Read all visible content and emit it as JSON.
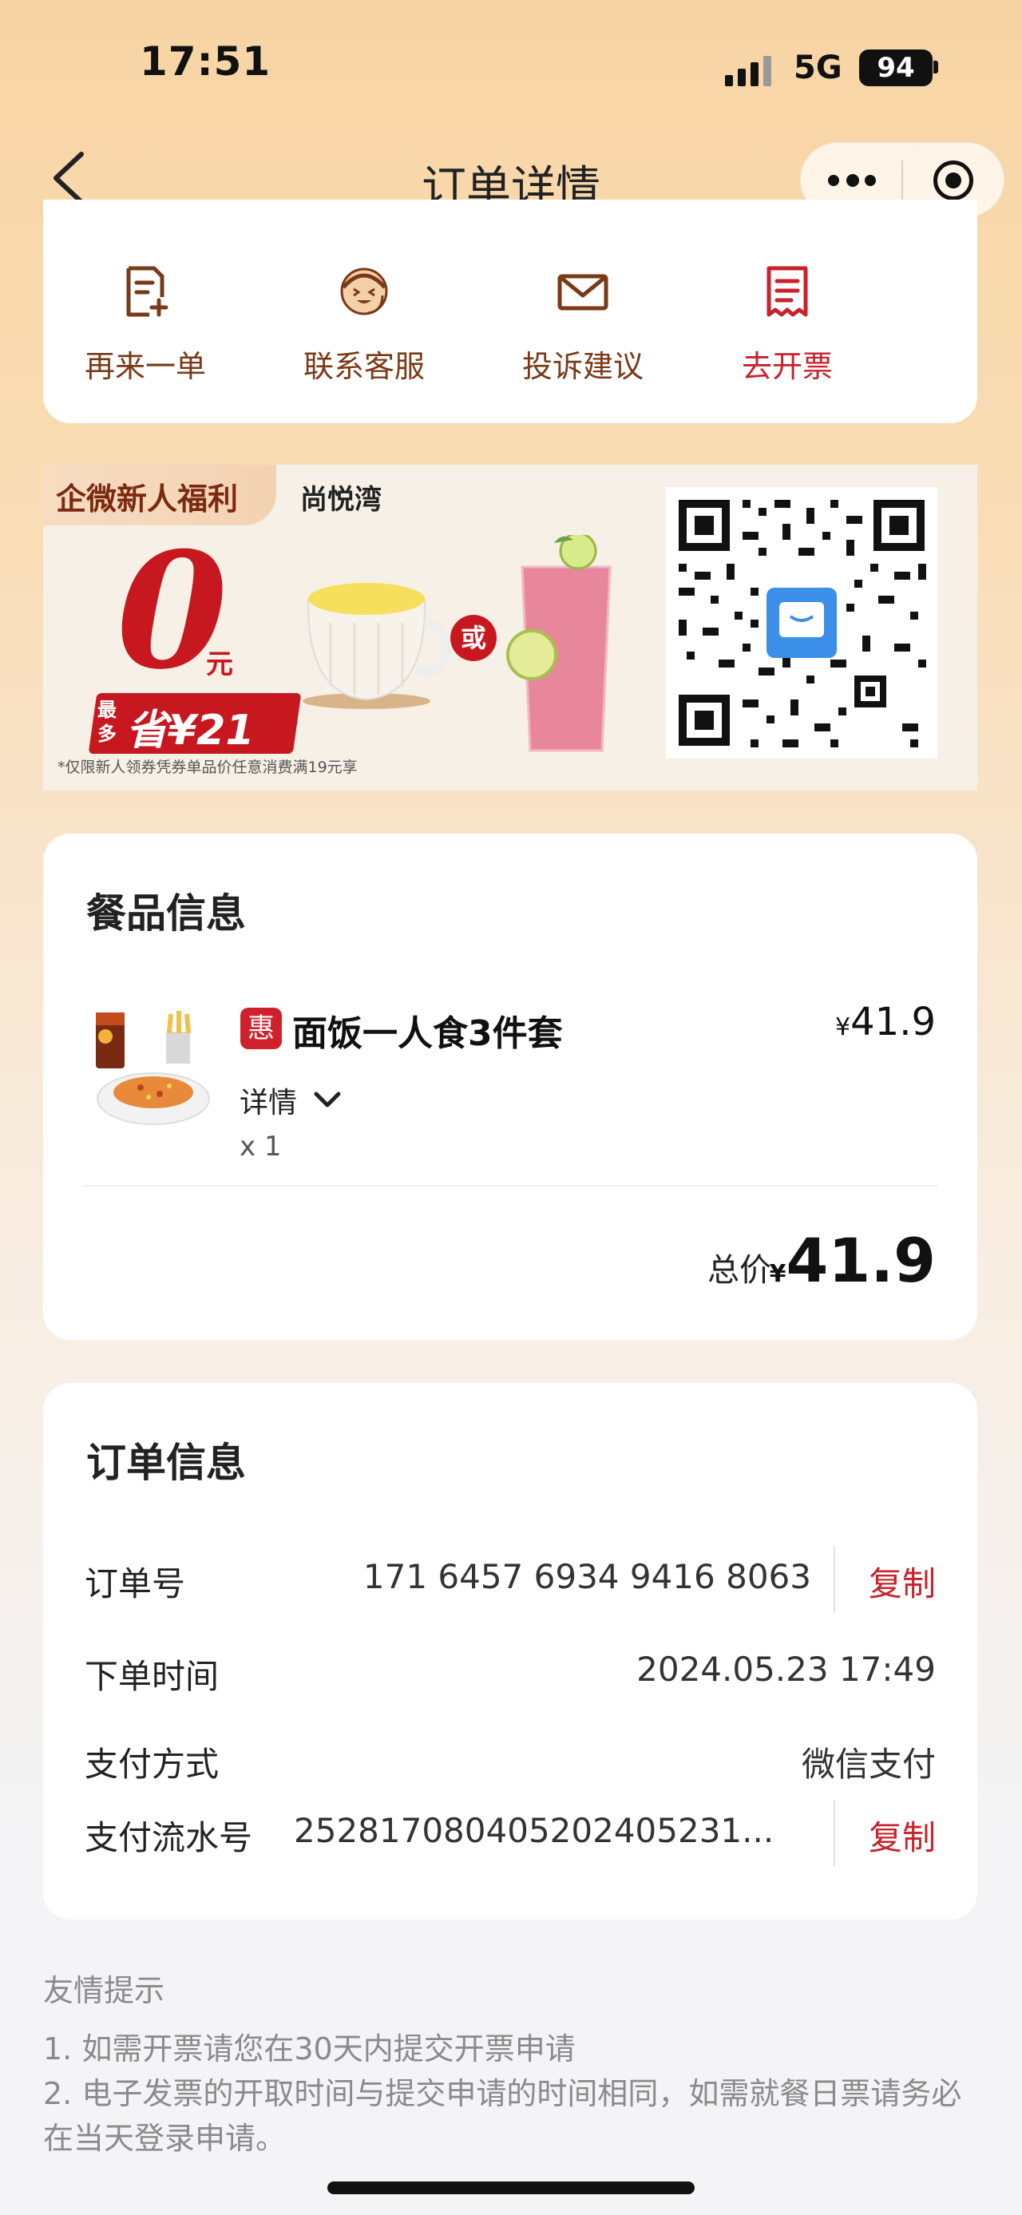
{
  "status_bar": {
    "time": "17:51",
    "network": "5G",
    "battery": "94"
  },
  "nav": {
    "title": "订单详情"
  },
  "actions": [
    {
      "label": "再来一单",
      "icon": "reorder-icon"
    },
    {
      "label": "联系客服",
      "icon": "customer-service-icon"
    },
    {
      "label": "投诉建议",
      "icon": "mail-icon"
    },
    {
      "label": "去开票",
      "icon": "invoice-icon"
    }
  ],
  "promo": {
    "tag": "企微新人福利",
    "store": "尚悦湾",
    "big_number": "0",
    "unit": "元",
    "save_small": "最多",
    "save_big": "省¥21",
    "or_text": "或",
    "note": "*仅限新人领券凭券单品价任意消费满19元享"
  },
  "food": {
    "section_title": "餐品信息",
    "badge": "惠",
    "name": "面饭一人食3件套",
    "currency": "¥",
    "price": "41.9",
    "detail_label": "详情",
    "qty": "x 1",
    "total_label": "总价",
    "total_currency": "¥",
    "total": "41.9"
  },
  "order": {
    "section_title": "订单信息",
    "order_no_label": "订单号",
    "order_no": "171 6457 6934 9416 8063",
    "copy_label": "复制",
    "time_label": "下单时间",
    "time": "2024.05.23 17:49",
    "pay_method_label": "支付方式",
    "pay_method": "微信支付",
    "pay_serial_label": "支付流水号",
    "pay_serial": "25281708040520240523​1..."
  },
  "tips": {
    "title": "友情提示",
    "items": [
      "1. 如需开票请您在30天内提交开票申请",
      "2. 电子发票的开取时间与提交申请的时间相同，如需就餐日票请务必在当天登录申请。"
    ]
  },
  "colors": {
    "accent_red": "#c8222a",
    "action_brown": "#7a3a18"
  }
}
